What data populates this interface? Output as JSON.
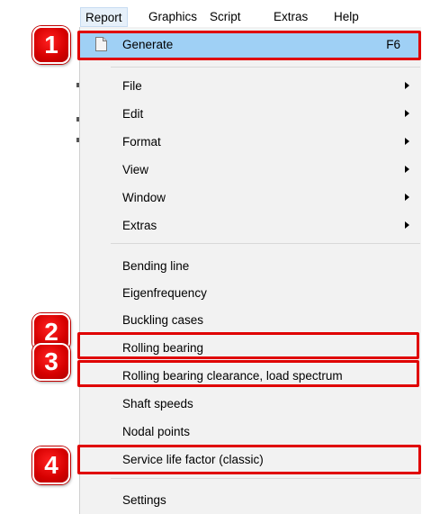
{
  "menubar": {
    "items": [
      {
        "label": "Report"
      },
      {
        "label": "Graphics"
      },
      {
        "label": "Script"
      },
      {
        "label": "Extras"
      },
      {
        "label": "Help"
      }
    ]
  },
  "menu": {
    "generate": {
      "label": "Generate",
      "shortcut": "F6"
    },
    "submenus": [
      {
        "label": "File"
      },
      {
        "label": "Edit"
      },
      {
        "label": "Format"
      },
      {
        "label": "View"
      },
      {
        "label": "Window"
      },
      {
        "label": "Extras"
      }
    ],
    "commands": [
      {
        "label": "Bending line"
      },
      {
        "label": "Eigenfrequency"
      },
      {
        "label": "Buckling cases"
      },
      {
        "label": "Rolling bearing"
      },
      {
        "label": "Rolling bearing clearance, load spectrum"
      },
      {
        "label": "Shaft speeds"
      },
      {
        "label": "Nodal points"
      },
      {
        "label": "Service life factor (classic)"
      }
    ],
    "settings": {
      "label": "Settings"
    }
  },
  "callouts": [
    {
      "number": "1"
    },
    {
      "number": "2"
    },
    {
      "number": "3"
    },
    {
      "number": "4"
    }
  ],
  "colors": {
    "highlight": "#9fd0f5",
    "callout_red": "#e00000",
    "menu_background": "#f2f2f2"
  },
  "icons": {
    "generate": "document-icon",
    "submenu": "submenu-arrow-icon"
  }
}
